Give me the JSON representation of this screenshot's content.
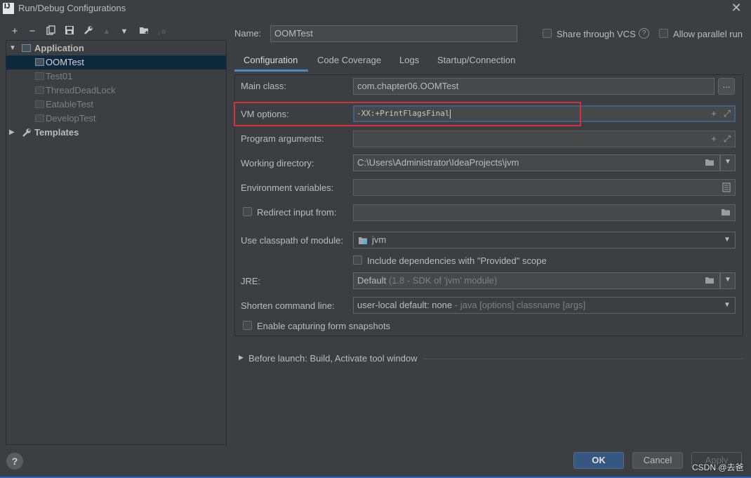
{
  "window": {
    "title": "Run/Debug Configurations",
    "app_icon": "intellij-icon",
    "close_icon": "close-icon"
  },
  "toolbar": {
    "icons": [
      "add-icon",
      "remove-icon",
      "copy-icon",
      "save-icon",
      "wrench-icon",
      "move-up-icon",
      "move-down-icon",
      "folder-add-icon",
      "sort-icon"
    ]
  },
  "tree": {
    "application": "Application",
    "templates": "Templates",
    "items": [
      "OOMTest",
      "Test01",
      "ThreadDeadLock",
      "EatableTest",
      "DevelopTest"
    ]
  },
  "header": {
    "name_label": "Name:",
    "name_value": "OOMTest",
    "share_vcs": "Share through VCS",
    "help_icon": "help-icon",
    "parallel": "Allow parallel run"
  },
  "tabs": [
    "Configuration",
    "Code Coverage",
    "Logs",
    "Startup/Connection"
  ],
  "form": {
    "main_class_label": "Main class:",
    "main_class_value": "com.chapter06.OOMTest",
    "browse_label": "...",
    "vm_label": "VM options:",
    "vm_value": "-XX:+PrintFlagsFinal",
    "args_label": "Program arguments:",
    "workdir_label": "Working directory:",
    "workdir_value": "C:\\Users\\Administrator\\IdeaProjects\\jvm",
    "env_label": "Environment variables:",
    "redirect_label": "Redirect input from:",
    "classpath_label": "Use classpath of module:",
    "classpath_value": "jvm",
    "include_deps": "Include dependencies with \"Provided\" scope",
    "jre_label": "JRE:",
    "jre_value": "Default",
    "jre_detail": "(1.8 - SDK of 'jvm' module)",
    "shorten_label": "Shorten command line:",
    "shorten_value": "user-local default: none",
    "shorten_detail": "- java [options] classname [args]",
    "snapshots": "Enable capturing form snapshots"
  },
  "before_launch": "Before launch: Build, Activate tool window",
  "buttons": {
    "ok": "OK",
    "cancel": "Cancel",
    "apply": "Apply",
    "help": "?"
  },
  "watermark": "CSDN @去爸"
}
